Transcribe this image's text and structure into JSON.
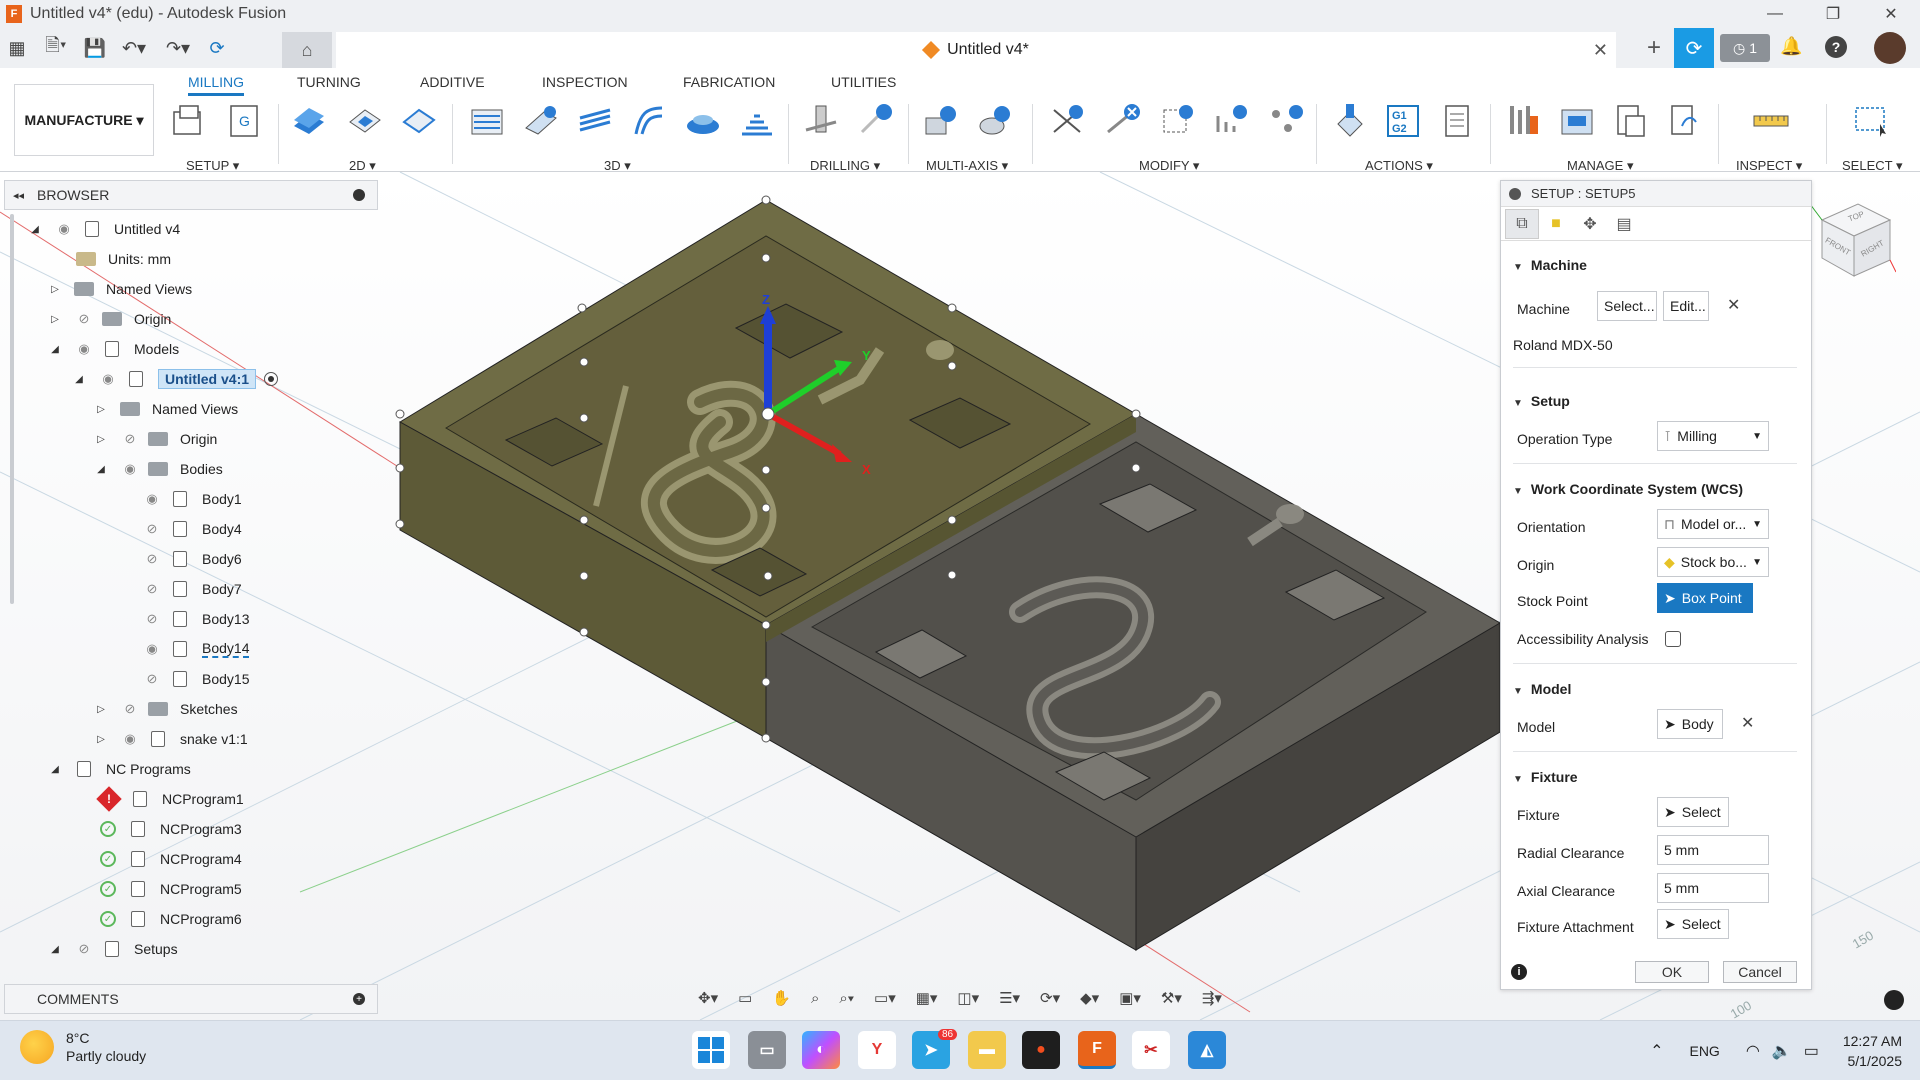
{
  "window": {
    "title": "Untitled v4* (edu) - Autodesk Fusion",
    "app_icon": "F"
  },
  "document_tab": {
    "title": "Untitled v4*"
  },
  "top_right": {
    "jobs_count": "1"
  },
  "workspace": {
    "label": "MANUFACTURE ▾"
  },
  "ribbon": {
    "tabs": [
      "MILLING",
      "TURNING",
      "ADDITIVE",
      "INSPECTION",
      "FABRICATION",
      "UTILITIES"
    ],
    "groups": [
      "SETUP ▾",
      "2D ▾",
      "3D ▾",
      "DRILLING ▾",
      "MULTI-AXIS ▾",
      "MODIFY ▾",
      "ACTIONS ▾",
      "MANAGE ▾",
      "INSPECT ▾",
      "SELECT ▾"
    ],
    "g1g2": "G1\nG2"
  },
  "browser": {
    "title": "BROWSER",
    "items": [
      {
        "label": "Untitled v4"
      },
      {
        "label": "Units: mm"
      },
      {
        "label": "Named Views"
      },
      {
        "label": "Origin"
      },
      {
        "label": "Models"
      },
      {
        "label": "Untitled v4:1"
      },
      {
        "label": "Named Views"
      },
      {
        "label": "Origin"
      },
      {
        "label": "Bodies"
      },
      {
        "label": "Body1"
      },
      {
        "label": "Body4"
      },
      {
        "label": "Body6"
      },
      {
        "label": "Body7"
      },
      {
        "label": "Body13"
      },
      {
        "label": "Body14"
      },
      {
        "label": "Body15"
      },
      {
        "label": "Sketches"
      },
      {
        "label": "snake v1:1"
      },
      {
        "label": "NC Programs"
      },
      {
        "label": "NCProgram1"
      },
      {
        "label": "NCProgram3"
      },
      {
        "label": "NCProgram4"
      },
      {
        "label": "NCProgram5"
      },
      {
        "label": "NCProgram6"
      },
      {
        "label": "Setups"
      }
    ]
  },
  "comments": {
    "title": "COMMENTS"
  },
  "axes": {
    "x": "X",
    "y": "Y",
    "z": "Z"
  },
  "viewcube": {
    "top": "TOP",
    "front": "FRONT",
    "right": "RIGHT"
  },
  "grid_labels": [
    "150",
    "100"
  ],
  "panel": {
    "title": "SETUP : SETUP5",
    "sections": {
      "machine": "Machine",
      "setup": "Setup",
      "wcs": "Work Coordinate System (WCS)",
      "model": "Model",
      "fixture": "Fixture"
    },
    "machine_label": "Machine",
    "machine_select": "Select...",
    "machine_edit": "Edit...",
    "machine_name": "Roland MDX-50",
    "operation_type_label": "Operation Type",
    "operation_type_value": "Milling",
    "orientation_label": "Orientation",
    "orientation_value": "Model or...",
    "origin_label": "Origin",
    "origin_value": "Stock bo...",
    "stock_point_label": "Stock Point",
    "stock_point_value": "Box Point",
    "accessibility_label": "Accessibility Analysis",
    "model_label": "Model",
    "model_value": "Body",
    "fixture_label": "Fixture",
    "fixture_value": "Select",
    "radial_label": "Radial Clearance",
    "radial_value": "5 mm",
    "axial_label": "Axial Clearance",
    "axial_value": "5 mm",
    "attachment_label": "Fixture Attachment",
    "attachment_value": "Select",
    "ok": "OK",
    "cancel": "Cancel"
  },
  "taskbar": {
    "temp": "8°C",
    "condition": "Partly cloudy",
    "lang": "ENG",
    "time": "12:27 AM",
    "date": "5/1/2025",
    "badge": "86",
    "fusion_label": "F"
  },
  "colors": {
    "accent": "#1a78c2",
    "body1": "#6f6c45",
    "body2": "#5e5c57"
  }
}
